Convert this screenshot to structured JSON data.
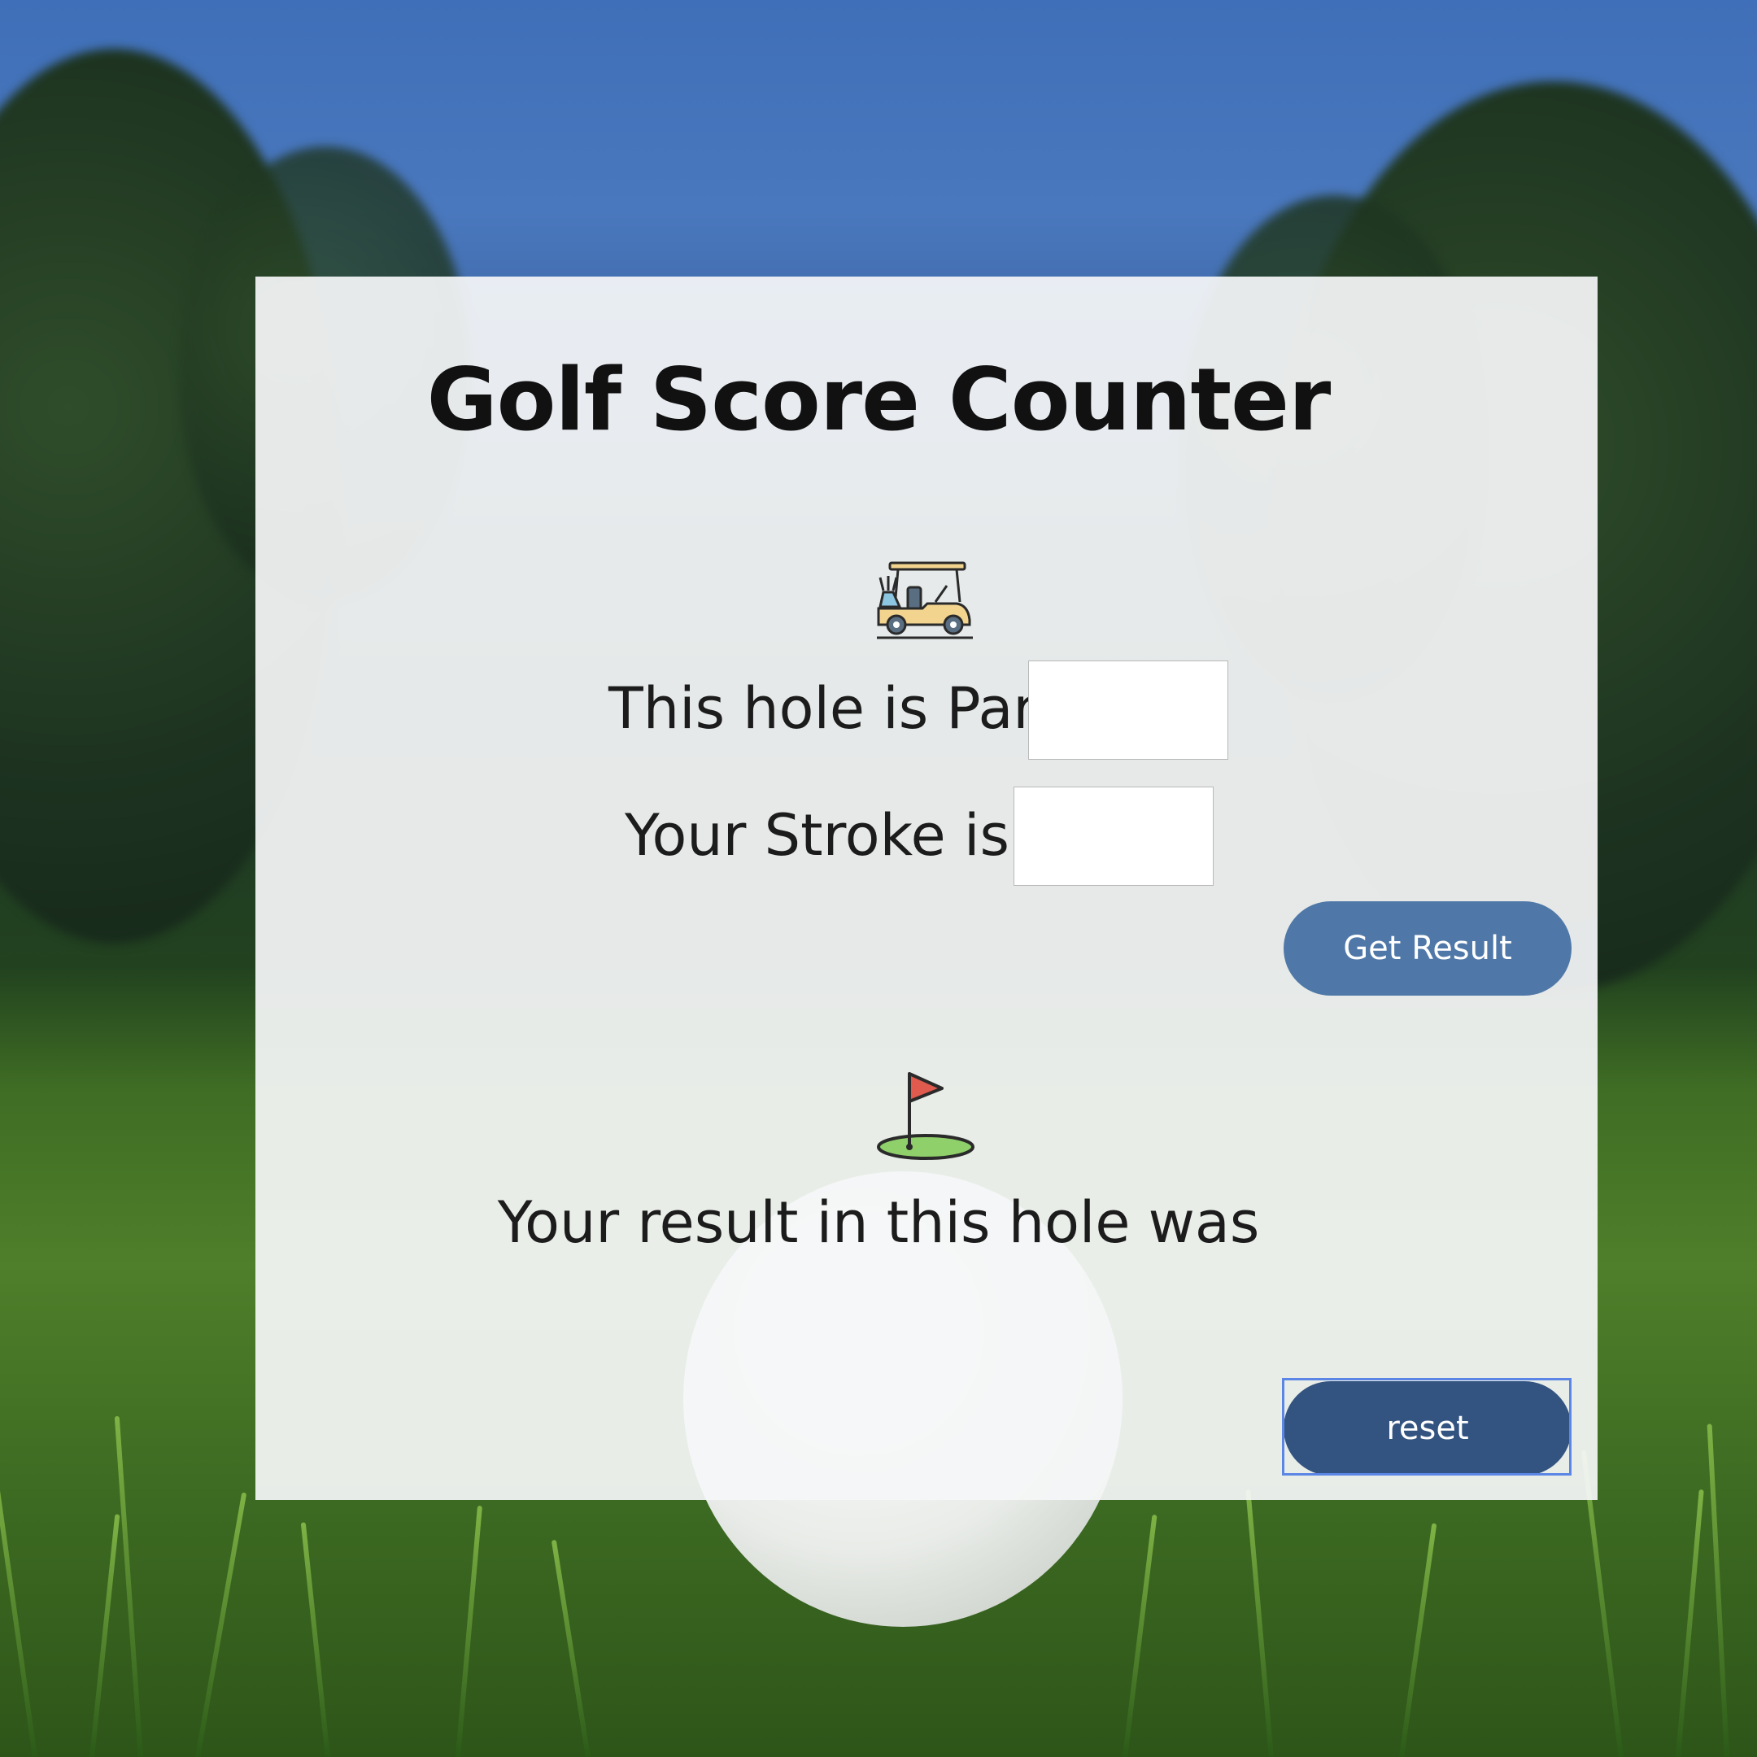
{
  "page": {
    "title": "Golf Score Counter"
  },
  "icons": {
    "cart": "golf-cart-icon",
    "flag": "golf-flag-icon"
  },
  "form": {
    "par_label": "This hole is Par",
    "par_value": "",
    "stroke_label": "Your Stroke is",
    "stroke_value": "",
    "get_result_label": "Get Result"
  },
  "result": {
    "text": "Your result in this hole was",
    "reset_label": "reset"
  },
  "colors": {
    "primary_button": "#4f78a8",
    "reset_button": "#335380",
    "focus_ring": "#5b86e5"
  }
}
